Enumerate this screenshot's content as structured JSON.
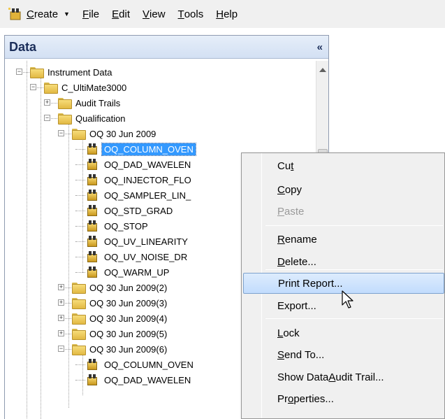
{
  "menubar": {
    "items": [
      {
        "name": "create",
        "underline": "C",
        "rest": "reate"
      },
      {
        "name": "file",
        "underline": "F",
        "rest": "ile"
      },
      {
        "name": "edit",
        "underline": "E",
        "rest": "dit"
      },
      {
        "name": "view",
        "underline": "V",
        "rest": "iew"
      },
      {
        "name": "tools",
        "underline": "T",
        "rest": "ools"
      },
      {
        "name": "help",
        "underline": "H",
        "rest": "elp"
      }
    ]
  },
  "panel": {
    "title": "Data",
    "collapse_glyph": "«"
  },
  "tree": [
    {
      "label": "Instrument Data",
      "icon": "folder",
      "expander": "−",
      "selected": false
    },
    {
      "label": "C_UltiMate3000",
      "icon": "folder",
      "expander": "−",
      "selected": false
    },
    {
      "label": "Audit Trails",
      "icon": "folder",
      "expander": "+",
      "selected": false
    },
    {
      "label": "Qualification",
      "icon": "folder",
      "expander": "−",
      "selected": false
    },
    {
      "label": "OQ 30 Jun 2009",
      "icon": "folder",
      "expander": "−",
      "selected": false
    },
    {
      "label": "OQ_COLUMN_OVEN",
      "icon": "sequence",
      "expander": "",
      "selected": true
    },
    {
      "label": "OQ_DAD_WAVELEN",
      "icon": "sequence",
      "expander": "",
      "selected": false
    },
    {
      "label": "OQ_INJECTOR_FLO",
      "icon": "sequence",
      "expander": "",
      "selected": false
    },
    {
      "label": "OQ_SAMPLER_LIN_",
      "icon": "sequence",
      "expander": "",
      "selected": false
    },
    {
      "label": "OQ_STD_GRAD",
      "icon": "sequence",
      "expander": "",
      "selected": false
    },
    {
      "label": "OQ_STOP",
      "icon": "sequence",
      "expander": "",
      "selected": false
    },
    {
      "label": "OQ_UV_LINEARITY",
      "icon": "sequence",
      "expander": "",
      "selected": false
    },
    {
      "label": "OQ_UV_NOISE_DR",
      "icon": "sequence",
      "expander": "",
      "selected": false
    },
    {
      "label": "OQ_WARM_UP",
      "icon": "sequence",
      "expander": "",
      "selected": false
    },
    {
      "label": "OQ 30 Jun 2009(2)",
      "icon": "folder",
      "expander": "+",
      "selected": false
    },
    {
      "label": "OQ 30 Jun 2009(3)",
      "icon": "folder",
      "expander": "+",
      "selected": false
    },
    {
      "label": "OQ 30 Jun 2009(4)",
      "icon": "folder",
      "expander": "+",
      "selected": false
    },
    {
      "label": "OQ 30 Jun 2009(5)",
      "icon": "folder",
      "expander": "+",
      "selected": false
    },
    {
      "label": "OQ 30 Jun 2009(6)",
      "icon": "folder",
      "expander": "−",
      "selected": false
    },
    {
      "label": "OQ_COLUMN_OVEN",
      "icon": "sequence",
      "expander": "",
      "selected": false
    },
    {
      "label": "OQ_DAD_WAVELEN",
      "icon": "sequence",
      "expander": "",
      "selected": false
    }
  ],
  "context_menu": {
    "items": [
      {
        "name": "cut",
        "pre": "Cu",
        "u": "t",
        "post": "",
        "disabled": false,
        "highlighted": false
      },
      {
        "name": "copy",
        "pre": "",
        "u": "C",
        "post": "opy",
        "disabled": false,
        "highlighted": false
      },
      {
        "name": "paste",
        "pre": "",
        "u": "P",
        "post": "aste",
        "disabled": true,
        "highlighted": false
      },
      {
        "name": "rename",
        "pre": "",
        "u": "R",
        "post": "ename",
        "disabled": false,
        "highlighted": false
      },
      {
        "name": "delete",
        "pre": "",
        "u": "D",
        "post": "elete...",
        "disabled": false,
        "highlighted": false
      },
      {
        "name": "print-report",
        "pre": "Print Report...",
        "u": "",
        "post": "",
        "disabled": false,
        "highlighted": true
      },
      {
        "name": "export",
        "pre": "Export...",
        "u": "",
        "post": "",
        "disabled": false,
        "highlighted": false
      },
      {
        "name": "lock",
        "pre": "",
        "u": "L",
        "post": "ock",
        "disabled": false,
        "highlighted": false
      },
      {
        "name": "send-to",
        "pre": "",
        "u": "S",
        "post": "end To...",
        "disabled": false,
        "highlighted": false
      },
      {
        "name": "show-data-audit-trail",
        "pre": "Show Data ",
        "u": "A",
        "post": "udit Trail...",
        "disabled": false,
        "highlighted": false
      },
      {
        "name": "properties",
        "pre": "Pr",
        "u": "o",
        "post": "perties...",
        "disabled": false,
        "highlighted": false
      }
    ]
  },
  "colors": {
    "selection": "#3399ff",
    "menu_highlight": "#c2dcfd",
    "folder": "#f7dc7a"
  }
}
